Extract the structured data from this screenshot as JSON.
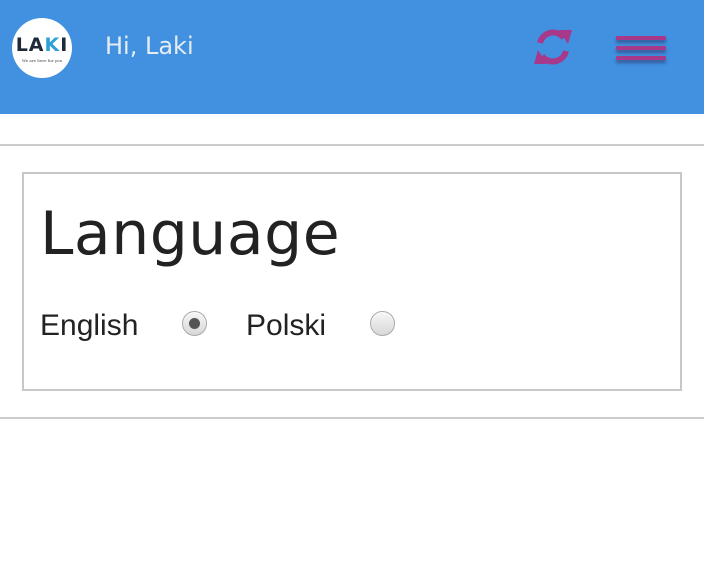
{
  "header": {
    "background_color": "#4191e0",
    "logo": {
      "word_part1": "LA",
      "word_part2": "K",
      "word_part3": "I",
      "tagline": "We are here for you"
    },
    "greeting": "Hi, Laki",
    "refresh_icon": "refresh-icon",
    "menu_icon": "hamburger-menu-icon",
    "accent_color": "#a7388a"
  },
  "language_panel": {
    "title": "Language",
    "options": [
      {
        "label": "English",
        "selected": true
      },
      {
        "label": "Polski",
        "selected": false
      }
    ]
  }
}
